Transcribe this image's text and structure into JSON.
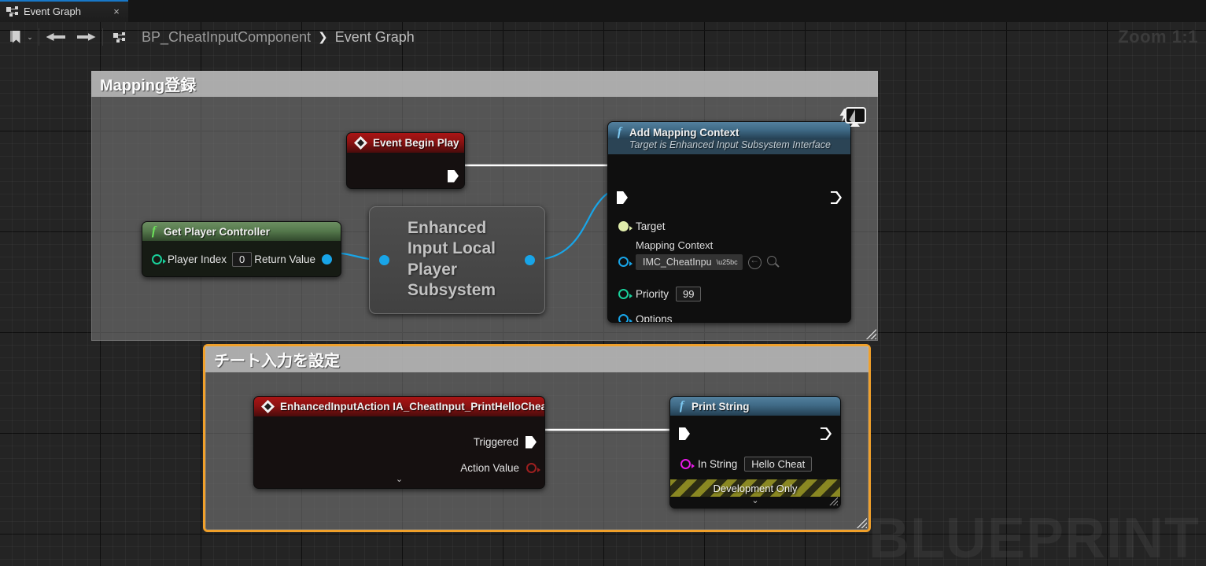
{
  "window": {
    "tab": {
      "label": "Event Graph",
      "icon": "graph-icon",
      "close": "×"
    },
    "zoom_label": "Zoom 1:1",
    "watermark": "BLUEPRINT"
  },
  "toolbar": {
    "bookmark_icon": "bookmark-icon",
    "chevron": "⌄",
    "back_icon": "arrow-left-icon",
    "forward_icon": "arrow-right-icon",
    "graph_icon": "graph-icon",
    "breadcrumb": [
      {
        "label": "BP_CheatInputComponent",
        "current": false
      },
      {
        "label": "Event Graph",
        "current": true
      }
    ],
    "separator": "❯"
  },
  "comments": [
    {
      "title": "Mapping登録",
      "selected": false
    },
    {
      "title": "チート入力を設定",
      "selected": true,
      "accent": "#f0a02a"
    }
  ],
  "nodes": {
    "event_begin_play": {
      "title": "Event Begin Play",
      "icon": "event-diamond-icon",
      "stop_icon": "breakpoint-square-icon",
      "out_exec": ""
    },
    "get_player_controller": {
      "title": "Get Player Controller",
      "icon": "function-f-icon",
      "in_label": "Player Index",
      "in_value": "0",
      "out_label": "Return Value"
    },
    "enhanced_subsystem": {
      "text": "Enhanced Input Local Player Subsystem"
    },
    "add_mapping_context": {
      "title": "Add Mapping Context",
      "subtitle": "Target is Enhanced Input Subsystem Interface",
      "icon": "function-f-icon",
      "watch_icon": "watch-value-icon",
      "pins": [
        {
          "label": "Target"
        },
        {
          "label": "Mapping Context",
          "dropdown": "IMC_CheatInpu",
          "browse_icon": "browse-back-icon",
          "search_icon": "search-icon"
        },
        {
          "label": "Priority",
          "value": "99"
        },
        {
          "label": "Options"
        }
      ]
    },
    "enhanced_input_action": {
      "title": "EnhancedInputAction IA_CheatInput_PrintHelloCheat",
      "icon": "event-diamond-icon",
      "outputs": [
        {
          "label": "Triggered",
          "kind": "exec"
        },
        {
          "label": "Action Value",
          "kind": "struct"
        }
      ],
      "expander": "⌄"
    },
    "print_string": {
      "title": "Print String",
      "icon": "function-f-icon",
      "in_label": "In String",
      "in_value": "Hello Cheat",
      "dev_only": "Development Only",
      "expander": "⌄"
    }
  },
  "colors": {
    "exec_wire": "#ffffff",
    "object_wire": "#18a5e8",
    "accent_tab": "#1878c8",
    "comment_selected": "#f0a02a",
    "pin_object": "#18a5e8",
    "pin_object_light": "#e0edab",
    "pin_int": "#19d19b",
    "pin_string": "#e619e6",
    "pin_struct": "#9c1f1f"
  }
}
